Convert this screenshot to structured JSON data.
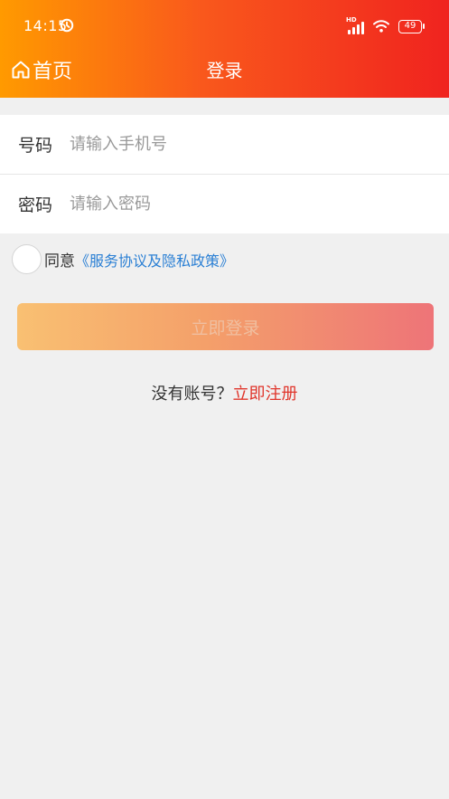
{
  "status_bar": {
    "time": "14:15",
    "network": "HD",
    "battery": "49"
  },
  "header": {
    "home_label": "首页",
    "title": "登录"
  },
  "form": {
    "phone_label": "号码",
    "phone_placeholder": "请输入手机号",
    "password_label": "密码",
    "password_placeholder": "请输入密码"
  },
  "agreement": {
    "text": "同意",
    "link": "《服务协议及隐私政策》"
  },
  "login_button": "立即登录",
  "register": {
    "prompt": "没有账号？",
    "link": "立即注册"
  },
  "colors": {
    "header_gradient": [
      "#ff9a00",
      "#f9581c",
      "#f0231f"
    ],
    "button_gradient": [
      "#f9c072",
      "#f4a06a",
      "#ee7478"
    ],
    "link_blue": "#2a7fd4",
    "link_red": "#e0352b"
  }
}
